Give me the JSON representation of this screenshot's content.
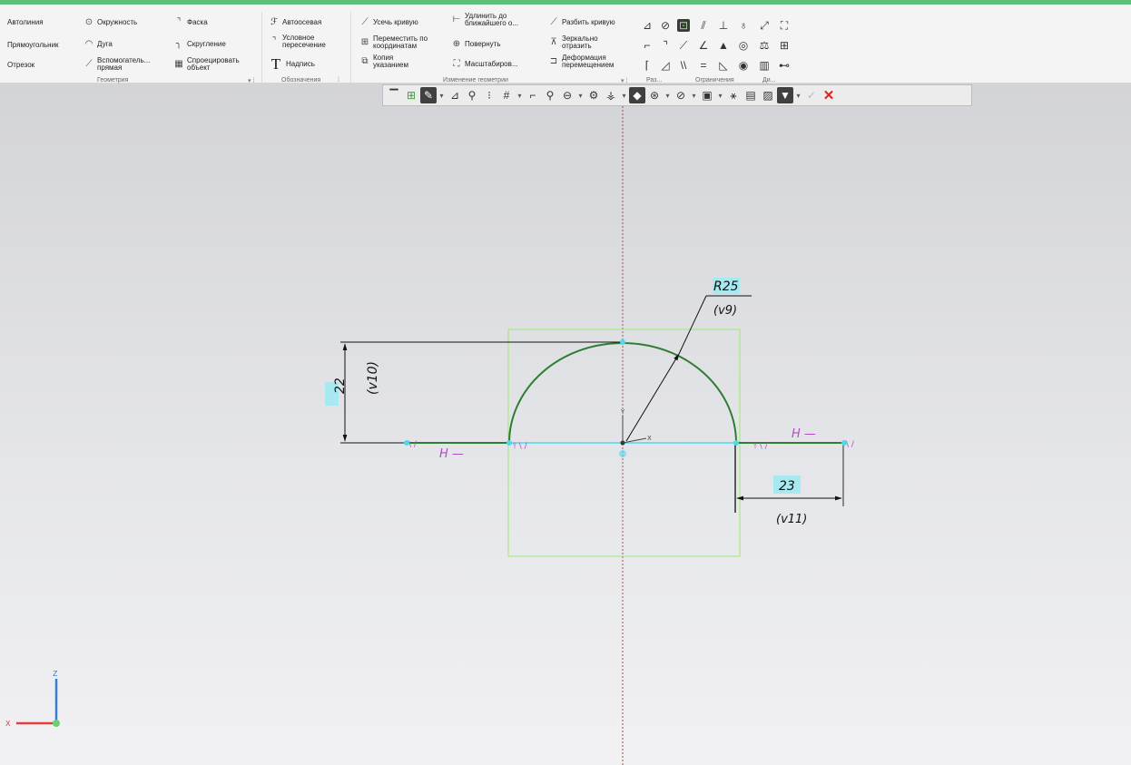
{
  "ribbon": {
    "geometry": {
      "autoline": "Автолиния",
      "rectangle": "Прямоугольник",
      "segment": "Отрезок",
      "circle": "Окружность",
      "arc": "Дуга",
      "aux_line": [
        "Вспомогатель...",
        "прямая"
      ],
      "chamfer": "Фаска",
      "fillet": "Скругление",
      "project": [
        "Спроецировать",
        "объект"
      ],
      "group_label": "Геометрия"
    },
    "designations": {
      "axis": "Автоосевая",
      "conditional_intersection": [
        "Условное",
        "пересечение"
      ],
      "label": "Надпись",
      "group_label": "Обозначения"
    },
    "edit": {
      "trim": "Усечь кривую",
      "extend": [
        "Удлинить до",
        "ближайшего о..."
      ],
      "split": "Разбить кривую",
      "move_coords": [
        "Переместить по",
        "координатам"
      ],
      "rotate": "Повернуть",
      "mirror": [
        "Зеркально",
        "отразить"
      ],
      "copy": [
        "Копия",
        "указанием"
      ],
      "scale": "Масштабиров...",
      "deform": [
        "Деформация",
        "перемещением"
      ],
      "group_label": "Изменение геометрии"
    },
    "small_groups": {
      "dimensions": "Раз...",
      "constraints": "Ограничения",
      "diagnostics": "Ди..."
    }
  },
  "float_toolbar": {
    "icons": [
      "view-icon",
      "cs-icon",
      "pen-icon",
      "dim-icon",
      "snap-icon",
      "point-icon",
      "grid-icon",
      "ortho-icon",
      "zoom-icon",
      "zoom-window-icon",
      "orient-icon",
      "light-icon",
      "render-icon",
      "section-icon",
      "hide-icon",
      "visibility-icon",
      "settings-icon",
      "filter-icon",
      "ok-icon",
      "cancel-icon"
    ]
  },
  "drawing": {
    "radius_dim": "R25",
    "radius_var": "(v9)",
    "height_dim": "22",
    "height_var": "(v10)",
    "width_dim": "23",
    "width_var": "(v11)",
    "h_constraint": "H —",
    "axis_x": "X",
    "axis_y": "Y",
    "axis_z": "Z"
  },
  "colors": {
    "accent": "#5cc07a",
    "curve": "#2e7d32",
    "dimension_box": "#a8e8f0",
    "constraint": "#b04fc0",
    "bounding_box": "#9fe870"
  }
}
